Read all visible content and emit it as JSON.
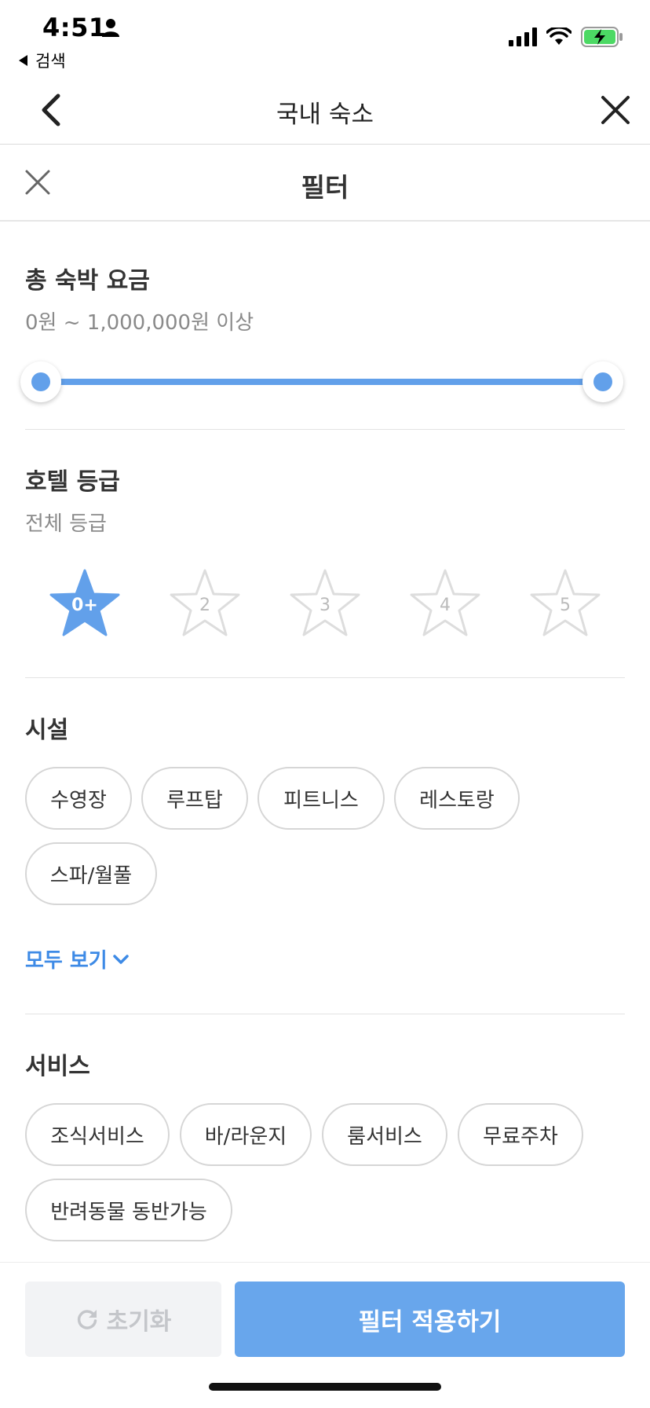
{
  "status": {
    "time": "4:51",
    "back_app": "검색",
    "icons": [
      "person-icon",
      "signal-icon",
      "wifi-icon",
      "battery-charging-icon"
    ]
  },
  "nav": {
    "title": "국내 숙소"
  },
  "filter": {
    "title": "필터"
  },
  "price": {
    "title": "총 숙박 요금",
    "range_text": "0원 ~ 1,000,000원 이상",
    "min_value": 0,
    "max_value": 1000000
  },
  "rating": {
    "title": "호텔 등급",
    "subtitle": "전체 등급",
    "stars": [
      {
        "label": "0+",
        "selected": true
      },
      {
        "label": "2",
        "selected": false
      },
      {
        "label": "3",
        "selected": false
      },
      {
        "label": "4",
        "selected": false
      },
      {
        "label": "5",
        "selected": false
      }
    ]
  },
  "facilities": {
    "title": "시설",
    "chips": [
      "수영장",
      "루프탑",
      "피트니스",
      "레스토랑",
      "스파/월풀"
    ],
    "see_all": "모두 보기"
  },
  "services": {
    "title": "서비스",
    "chips": [
      "조식서비스",
      "바/라운지",
      "룸서비스",
      "무료주차",
      "반려동물 동반가능"
    ]
  },
  "footer": {
    "reset_label": "초기화",
    "apply_label": "필터 적용하기"
  },
  "colors": {
    "accent": "#62a0ea",
    "apply_button": "#68a6ec",
    "link": "#3d8ae6",
    "chip_border": "#d6d6d6"
  }
}
